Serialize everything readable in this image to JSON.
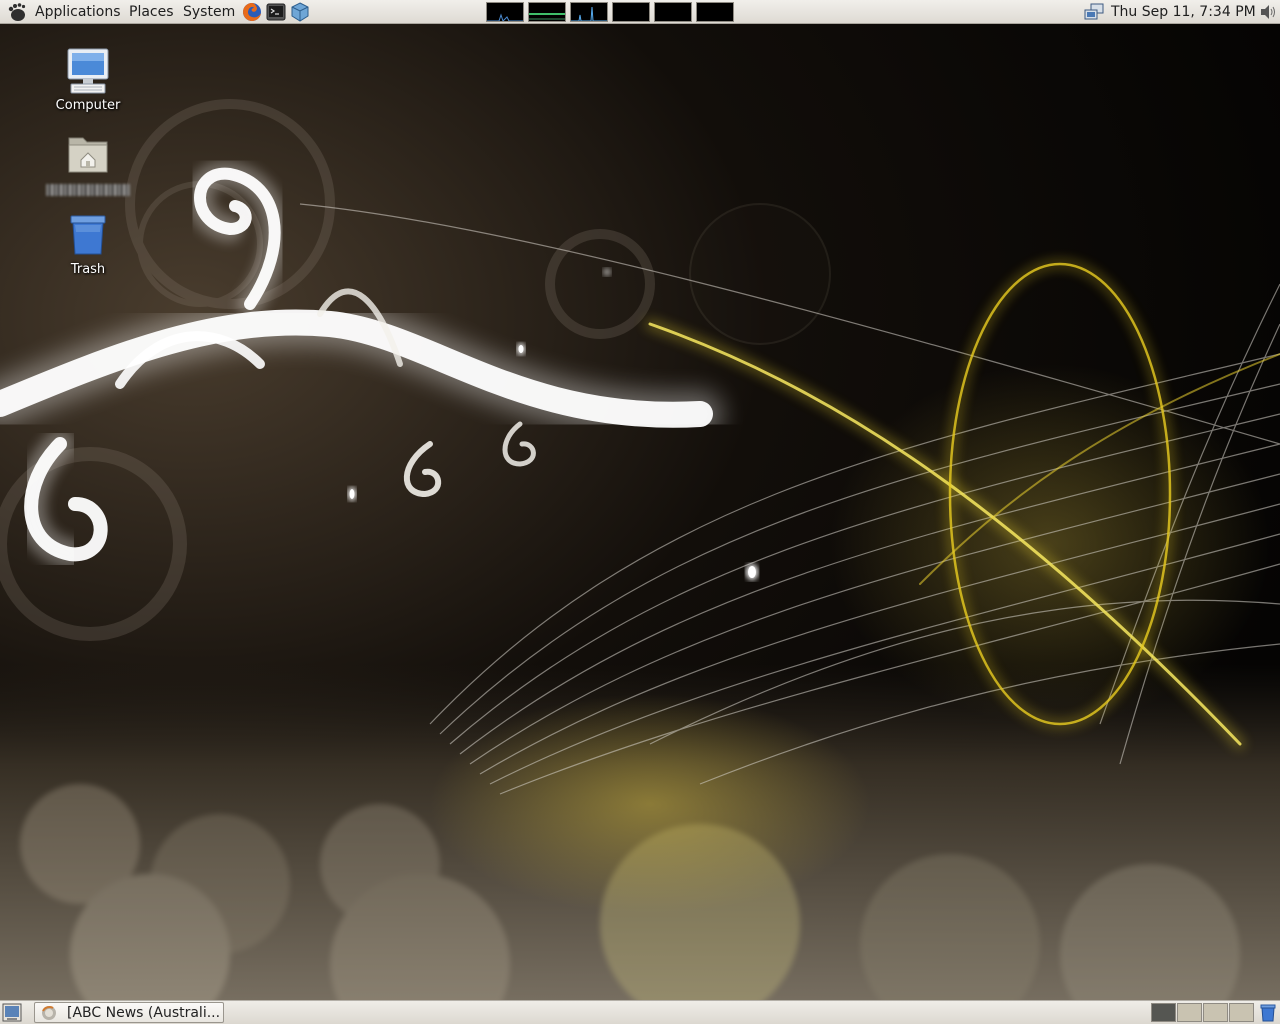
{
  "top_panel": {
    "menus": {
      "applications": "Applications",
      "places": "Places",
      "system": "System"
    },
    "launchers": [
      "firefox-icon",
      "terminal-icon",
      "virtualbox-icon"
    ],
    "monitors": [
      "cpu-monitor",
      "memory-monitor",
      "network-monitor",
      "swap-monitor",
      "load-monitor",
      "disk-monitor"
    ],
    "clock": "Thu Sep 11,  7:34 PM"
  },
  "desktop": {
    "icons": {
      "computer": "Computer",
      "home": "",
      "trash": "Trash"
    }
  },
  "bottom_panel": {
    "tasks": [
      {
        "label": "[ABC News (Australi..."
      }
    ],
    "workspaces": 4,
    "active_workspace": 1
  },
  "colors": {
    "panel_bg": "#e6e3de",
    "accent_yellow": "#e8d030",
    "active_workspace": "#555652"
  }
}
